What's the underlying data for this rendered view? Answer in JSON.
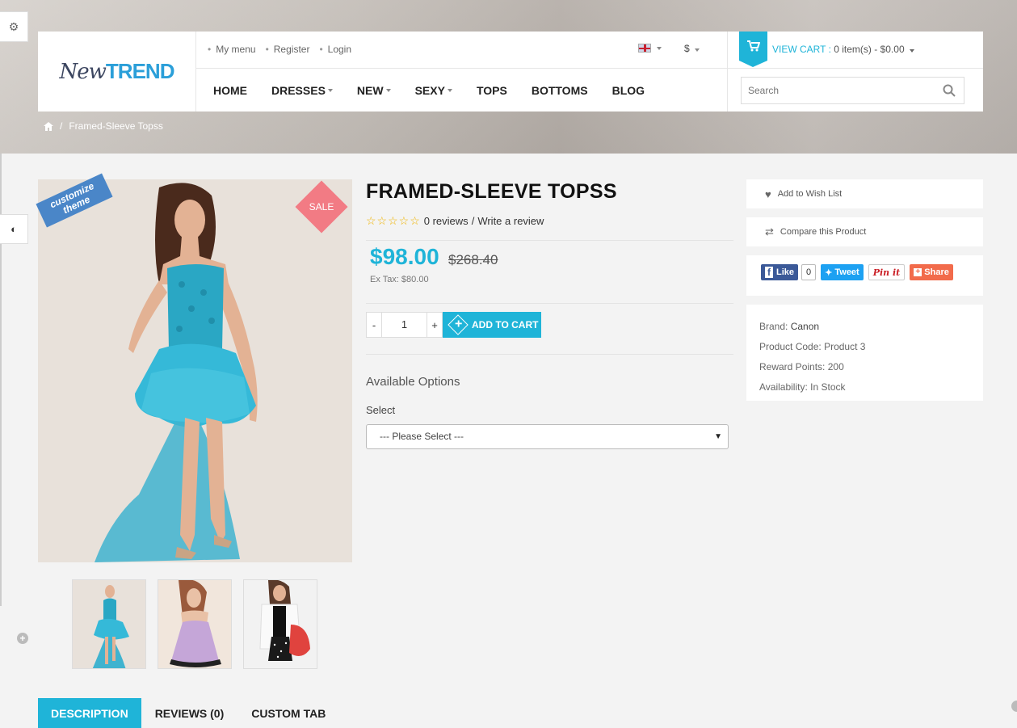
{
  "theme": {
    "accent": "#1fb4d8",
    "sale": "#f27b84",
    "ribbon": "#4a86c8"
  },
  "header": {
    "logo": {
      "part1": "New",
      "part2": "TREND"
    },
    "top_links": [
      "My menu",
      "Register",
      "Login"
    ],
    "currency": "$",
    "cart": {
      "label": "VIEW CART :",
      "summary": "0 item(s) - $0.00"
    },
    "search_placeholder": "Search",
    "nav": [
      {
        "label": "HOME",
        "dropdown": false
      },
      {
        "label": "DRESSES",
        "dropdown": true
      },
      {
        "label": "NEW",
        "dropdown": true
      },
      {
        "label": "SEXY",
        "dropdown": true
      },
      {
        "label": "TOPS",
        "dropdown": false
      },
      {
        "label": "BOTTOMS",
        "dropdown": false
      },
      {
        "label": "BLOG",
        "dropdown": false
      }
    ]
  },
  "breadcrumb": {
    "separator": "/",
    "current": "Framed-Sleeve Topss"
  },
  "product": {
    "badge": "SALE",
    "ribbon": "customize theme",
    "title": "FRAMED-SLEEVE TOPSS",
    "reviews": "0 reviews",
    "review_sep": "/",
    "write_review": "Write a review",
    "price": "$98.00",
    "old_price": "$268.40",
    "ex_tax": "Ex Tax: $80.00",
    "qty": "1",
    "qty_minus": "-",
    "qty_plus": "+",
    "add_to_cart": "ADD TO CART",
    "options_title": "Available Options",
    "select_label": "Select",
    "select_value": "--- Please Select ---",
    "rating": 0
  },
  "side": {
    "wishlist": "Add to Wish List",
    "compare": "Compare this Product",
    "social": {
      "like": "Like",
      "like_count": "0",
      "tweet": "Tweet",
      "pin": "Pin it",
      "share": "Share"
    },
    "meta": [
      {
        "label": "Brand:",
        "value": "Canon"
      },
      {
        "label": "Product Code:",
        "value": "Product 3"
      },
      {
        "label": "Reward Points:",
        "value": "200"
      },
      {
        "label": "Availability:",
        "value": "In Stock"
      }
    ]
  },
  "tabs": [
    "DESCRIPTION",
    "REVIEWS (0)",
    "CUSTOM TAB"
  ]
}
